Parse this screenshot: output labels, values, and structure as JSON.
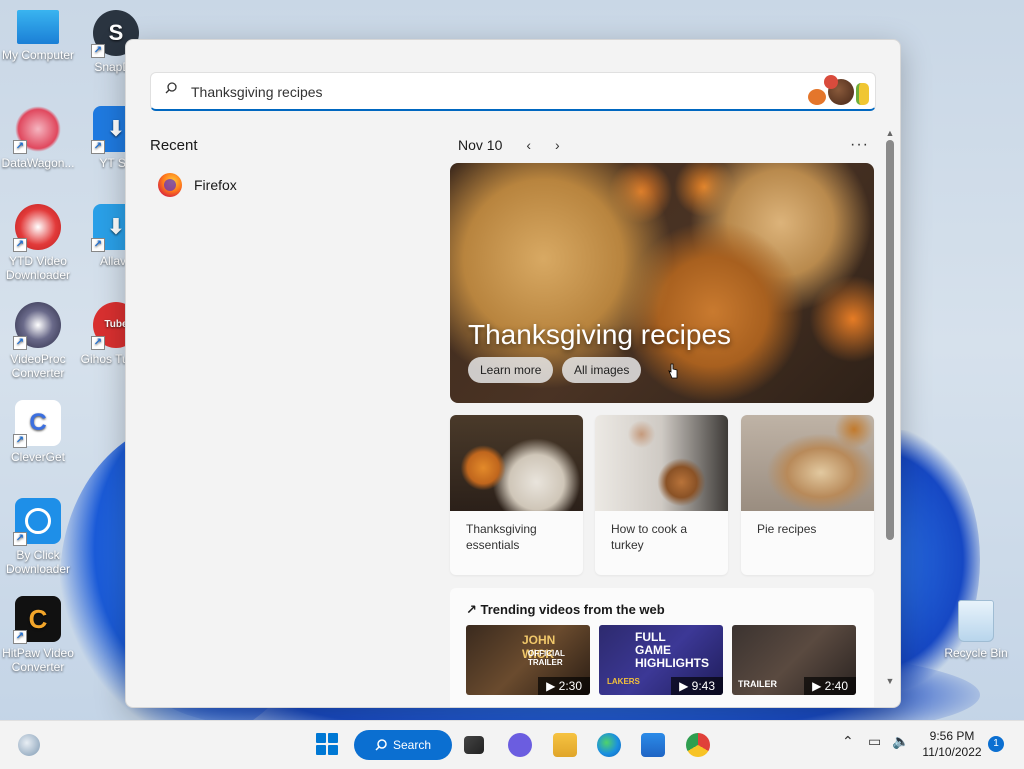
{
  "desktop": {
    "icons": [
      {
        "label": "My Computer"
      },
      {
        "label": "SnapDo"
      },
      {
        "label": "DataWagon..."
      },
      {
        "label": "YT Sa"
      },
      {
        "label": "YTD Video Downloader"
      },
      {
        "label": "Allavs"
      },
      {
        "label": "VideoProc Converter"
      },
      {
        "label": "Gihos TubeG"
      },
      {
        "label": "CleverGet"
      },
      {
        "label": "By Click Downloader"
      },
      {
        "label": "HitPaw Video Converter"
      },
      {
        "label": "Recycle Bin"
      }
    ]
  },
  "search": {
    "query": "Thanksgiving recipes",
    "recent_title": "Recent",
    "recent_items": [
      {
        "label": "Firefox"
      }
    ],
    "date": "Nov 10",
    "prev": "‹",
    "next": "›",
    "more": "···",
    "hero": {
      "title": "Thanksgiving recipes",
      "learn_more": "Learn more",
      "all_images": "All images"
    },
    "cards": [
      {
        "label": "Thanksgiving essentials"
      },
      {
        "label": "How to cook a turkey"
      },
      {
        "label": "Pie recipes"
      }
    ],
    "trending": {
      "title": "Trending videos from the web",
      "videos": [
        {
          "overlay": "JOHN WICK",
          "sub": "OFFICIAL TRAILER",
          "duration": "2:30"
        },
        {
          "overlay": "FULL GAME HIGHLIGHTS",
          "sub": "LAKERS",
          "duration": "9:43"
        },
        {
          "overlay": "TRAILER",
          "sub": "",
          "duration": "2:40"
        }
      ]
    }
  },
  "taskbar": {
    "search_label": "Search",
    "time": "9:56 PM",
    "date": "11/10/2022",
    "notifications": "1"
  },
  "colors": {
    "accent": "#0b6fd1",
    "panel_bg": "#f3f3f3"
  }
}
